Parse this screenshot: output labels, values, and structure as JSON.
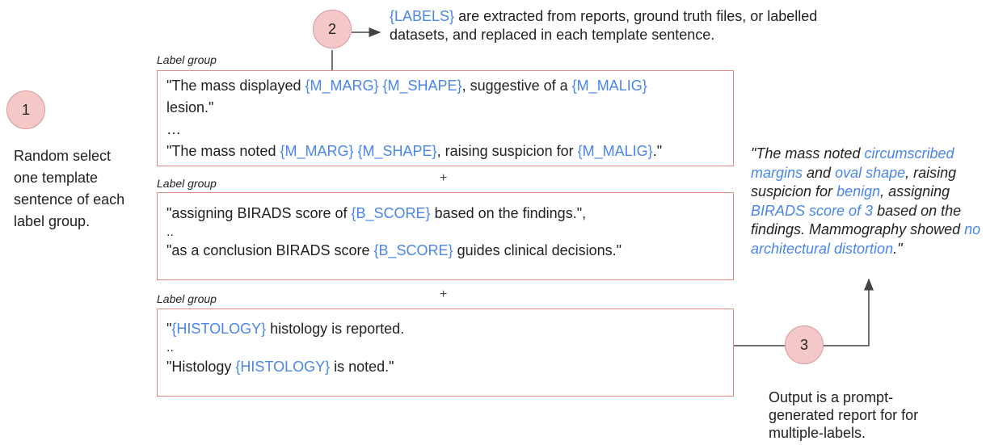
{
  "steps": {
    "one": "1",
    "two": "2",
    "three": "3"
  },
  "step1_text": "Random select one template sentence of each label group.",
  "step2_text": {
    "label_token": "{LABELS}",
    "rest_line1": " are extracted from reports, ground truth files, or labelled",
    "line2": "datasets, and replaced in each template sentence."
  },
  "group_label": "Label group",
  "plus": "+",
  "group1": {
    "l1_a": "\"The mass displayed ",
    "l1_b": "{M_MARG}",
    "l1_c": " ",
    "l1_d": "{M_SHAPE}",
    "l1_e": ", suggestive of a ",
    "l1_f": "{M_MALIG}",
    "l2": "lesion.\"",
    "l3": "…",
    "l4_a": "\"The mass noted ",
    "l4_b": "{M_MARG}",
    "l4_c": " ",
    "l4_d": "{M_SHAPE}",
    "l4_e": ", raising suspicion for ",
    "l4_f": "{M_MALIG}",
    "l4_g": ".\""
  },
  "group2": {
    "l1_a": "\"assigning BIRADS score of ",
    "l1_b": "{B_SCORE}",
    "l1_c": " based on the findings.\",",
    "l2": "..",
    "l3_a": "\"as a conclusion BIRADS score ",
    "l3_b": "{B_SCORE}",
    "l3_c": " guides clinical decisions.\""
  },
  "group3": {
    "l1_a": "\"",
    "l1_b": "{HISTOLOGY}",
    "l1_c": " histology is reported.",
    "l2": "..",
    "l3_a": "\"Histology ",
    "l3_b": "{HISTOLOGY}",
    "l3_c": " is noted.\""
  },
  "output_report": {
    "t1": "\"The mass noted ",
    "v1": "circumscribed margins",
    "t2": " and ",
    "v2": "oval shape",
    "t3": ", raising suspicion for ",
    "v3": "benign",
    "t4": ", assigning ",
    "v4": "BIRADS score of 3",
    "t5": " based on the findings. Mammography showed ",
    "v5": "no architectural distortion",
    "t6": ".\""
  },
  "step3_text": "Output is a prompt-generated report for for multiple-labels.",
  "colors": {
    "label_blue": "#4a86e8",
    "box_border": "#e08a8c",
    "circle_fill": "#f4c7c9"
  }
}
